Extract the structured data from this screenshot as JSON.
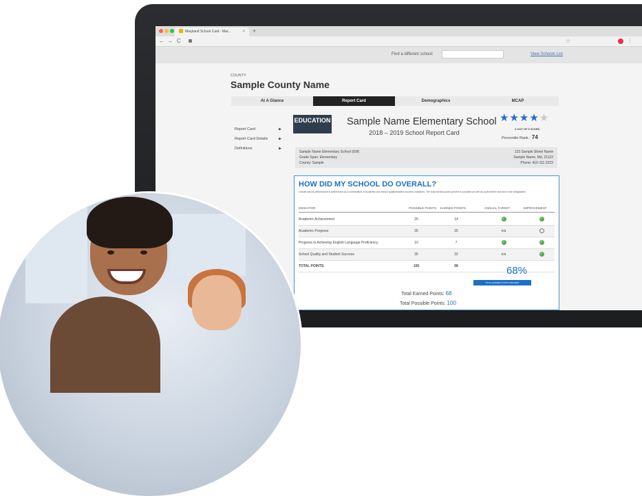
{
  "browser": {
    "tab_title": "Maryland School Card - Mar...",
    "tab_close": "×",
    "new_tab": "+",
    "nav": {
      "back": "←",
      "forward": "→",
      "reload": "C"
    },
    "bookmark_icon": "☆",
    "menu_icon": "⋮",
    "traffic_colors": [
      "#ff5f57",
      "#febc2e",
      "#28c840"
    ]
  },
  "site_header": {
    "find_label": "Find a different school:",
    "find_placeholder": "",
    "schools_link": "View Schools List"
  },
  "county": {
    "label": "COUNTY",
    "name": "Sample County Name"
  },
  "tabs": [
    "At A Glance",
    "Report Card",
    "Demographics",
    "MCAP"
  ],
  "active_tab": "Report Card",
  "left_menu": [
    {
      "label": "Report Card",
      "chevron": "▶"
    },
    {
      "label": "Report Card Details",
      "chevron": "▶"
    },
    {
      "label": "Definitions",
      "chevron": "▶"
    }
  ],
  "logo": {
    "top": "",
    "main": "EDUCATION",
    "sub": ""
  },
  "school": {
    "name": "Sample Name Elementary School",
    "year_line": "2018 – 2019 School Report Card",
    "stars_glyphs": "★★★★",
    "star_off_glyph": "★",
    "star_rating": 4,
    "stars_caption": "4 OUT OF 5 STARS",
    "percentile_label": "Percentile Rank :",
    "percentile_value": "74"
  },
  "info": {
    "left": [
      "Sample Name Elementary School (EM)",
      "Grade Span: Elementary",
      "County: Sample"
    ],
    "right": [
      "123 Sample Street Name",
      "Sample Name, Md. 21122",
      "Phone: 410-111-2222"
    ]
  },
  "overall": {
    "title": "HOW DID MY SCHOOL DO OVERALL?",
    "description": "Overall school performance is determined by a combination of academic and school quality/student success indicators. The total earned points percent is provided as well as a percentile rank and a star designation.",
    "headers": [
      "INDICATOR",
      "POSSIBLE POINTS",
      "EARNED POINTS",
      "ANNUAL TARGET",
      "IMPROVEMENT"
    ],
    "rows": [
      {
        "indicator": "Academic Achievement",
        "possible": "20",
        "earned": "14",
        "target": "check",
        "improvement": "check"
      },
      {
        "indicator": "Academic Progress",
        "possible": "35",
        "earned": "25",
        "target": "n/a",
        "improvement": "circle"
      },
      {
        "indicator": "Progress in Achieving English Language Proficiency",
        "possible": "10",
        "earned": "7",
        "target": "check",
        "improvement": "check"
      },
      {
        "indicator": "School Quality and Student Success",
        "possible": "35",
        "earned": "22",
        "target": "n/a",
        "improvement": "check"
      }
    ],
    "total": {
      "label": "TOTAL POINTS:",
      "possible": "100",
      "earned": "68"
    },
    "percent": "68%",
    "percent_button": "TOTAL EARNED POINTS PERCENT",
    "earned_label": "Total Earned Points:",
    "earned_value": "68",
    "possible_label": "Total Possible Points:",
    "possible_value": "100"
  },
  "colors": {
    "accent_blue": "#1f6fc5",
    "active_tab_bg": "#222222",
    "check_green": "#4caf50",
    "laptop_frame": "#232427"
  }
}
